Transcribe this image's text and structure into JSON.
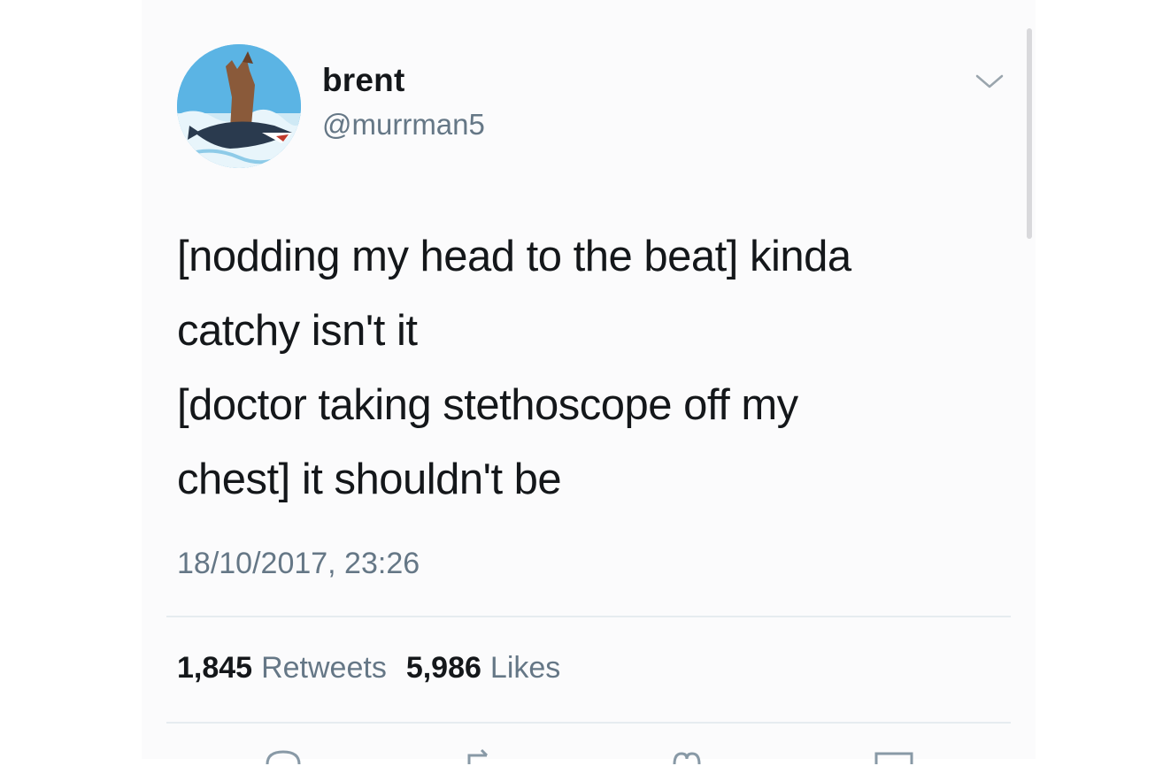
{
  "tweet": {
    "user": {
      "display_name": "brent",
      "handle": "@murrman5",
      "avatar_icon": "avatar-icon"
    },
    "text": "[nodding my head to the beat] kinda\ncatchy isn't it\n[doctor taking stethoscope off my\nchest] it shouldn't be",
    "timestamp": "18/10/2017, 23:26",
    "stats": {
      "retweets_count": "1,845",
      "retweets_label": "Retweets",
      "likes_count": "5,986",
      "likes_label": "Likes"
    },
    "menu_icon": "chevron-down-icon",
    "actions": [
      "reply-icon",
      "retweet-icon",
      "like-icon",
      "share-icon"
    ]
  },
  "colors": {
    "text_primary": "#14171a",
    "text_secondary": "#657786",
    "divider": "#e6ecf0"
  }
}
